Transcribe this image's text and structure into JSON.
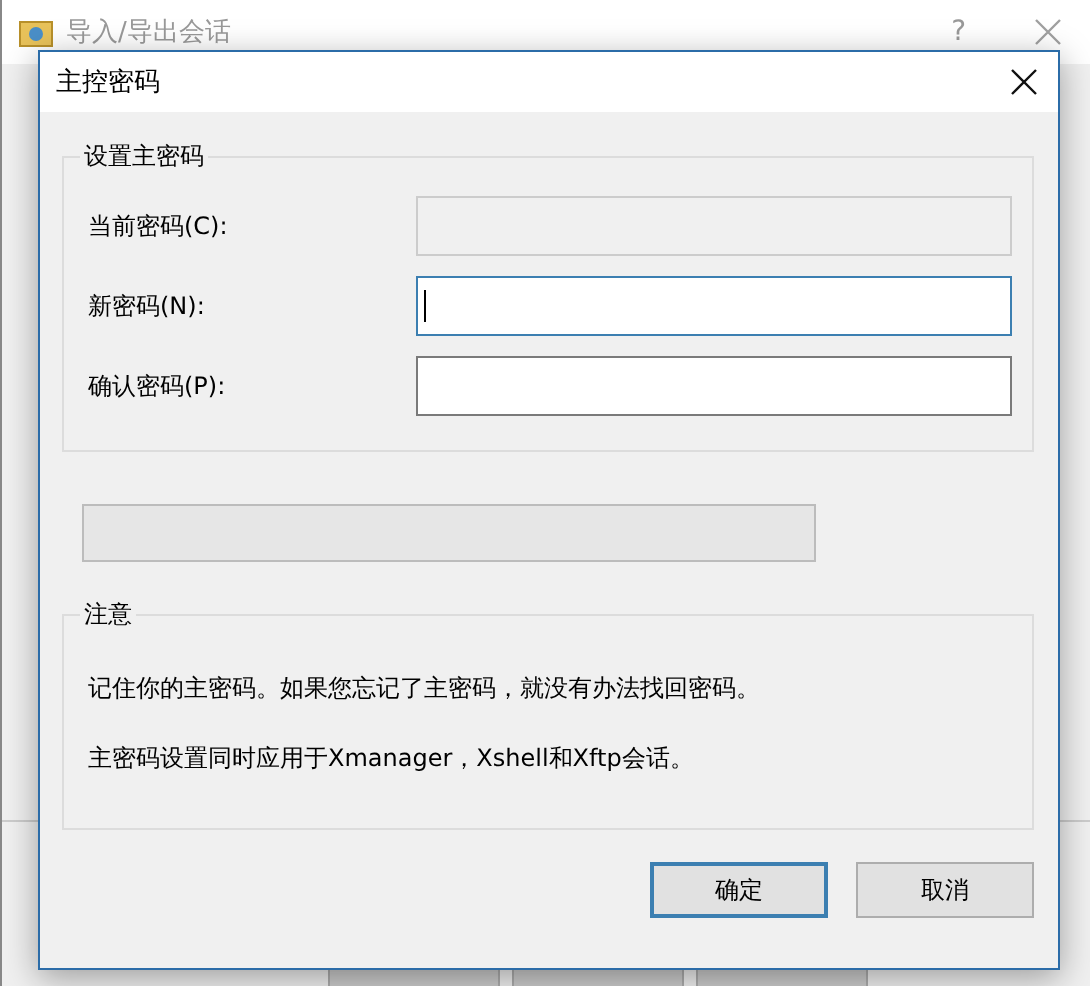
{
  "background_window": {
    "title": "导入/导出会话",
    "help": "?"
  },
  "dialog": {
    "title": "主控密码",
    "password_group": {
      "title": "设置主密码",
      "fields": [
        {
          "label": "当前密码(C):",
          "disabled": true,
          "focused": false
        },
        {
          "label": "新密码(N):",
          "disabled": false,
          "focused": true
        },
        {
          "label": "确认密码(P):",
          "disabled": false,
          "focused": false
        }
      ]
    },
    "strength_meter": {
      "level": 0
    },
    "notice_group": {
      "title": "注意",
      "lines": [
        "记住你的主密码。如果您忘记了主密码，就没有办法找回密码。",
        "主密码设置同时应用于Xmanager，Xshell和Xftp会话。"
      ]
    },
    "buttons": [
      {
        "label": "确定",
        "default": true
      },
      {
        "label": "取消",
        "default": false
      }
    ]
  }
}
